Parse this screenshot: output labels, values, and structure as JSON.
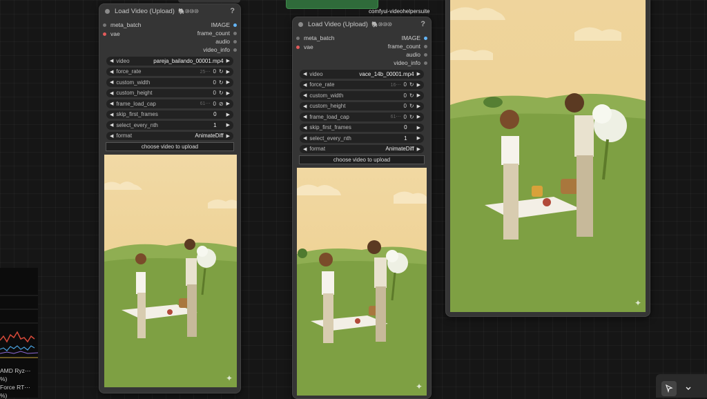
{
  "colors": {
    "canvas": "#161616",
    "node_bg": "#353535",
    "widget_bg": "#222222",
    "port_red": "#e25b5b",
    "port_blue": "#64b5f6"
  },
  "top_partial": {
    "group_label": "comfyui-videohelpersuite"
  },
  "nodes": [
    {
      "title": "Load Video (Upload)",
      "badges": "🐘⑩⑩⑩",
      "help": "?",
      "inputs": [
        "meta_batch",
        "vae"
      ],
      "outputs": [
        "IMAGE",
        "frame_count",
        "audio",
        "video_info"
      ],
      "widgets": [
        {
          "label": "video",
          "value": "pareja_bailando_00001.mp4",
          "ghost": "",
          "extra": ""
        },
        {
          "label": "force_rate",
          "value": "0",
          "ghost": "25⋯",
          "extra": "↻"
        },
        {
          "label": "custom_width",
          "value": "0",
          "ghost": "",
          "extra": "↻"
        },
        {
          "label": "custom_height",
          "value": "0",
          "ghost": "",
          "extra": "↻"
        },
        {
          "label": "frame_load_cap",
          "value": "0",
          "ghost": "61⋯",
          "extra": "⊘"
        },
        {
          "label": "skip_first_frames",
          "value": "0",
          "ghost": "",
          "extra": ""
        },
        {
          "label": "select_every_nth",
          "value": "1",
          "ghost": "",
          "extra": ""
        },
        {
          "label": "format",
          "value": "AnimateDiff",
          "ghost": "",
          "extra": ""
        }
      ],
      "upload_label": "choose video to upload"
    },
    {
      "title": "Load Video (Upload)",
      "badges": "🐘⑩⑩⑩",
      "help": "?",
      "inputs": [
        "meta_batch",
        "vae"
      ],
      "outputs": [
        "IMAGE",
        "frame_count",
        "audio",
        "video_info"
      ],
      "widgets": [
        {
          "label": "video",
          "value": "vace_14b_00001.mp4",
          "ghost": "",
          "extra": ""
        },
        {
          "label": "force_rate",
          "value": "0",
          "ghost": "16⋯",
          "extra": "↻"
        },
        {
          "label": "custom_width",
          "value": "0",
          "ghost": "",
          "extra": "↻"
        },
        {
          "label": "custom_height",
          "value": "0",
          "ghost": "",
          "extra": "↻"
        },
        {
          "label": "frame_load_cap",
          "value": "0",
          "ghost": "61⋯",
          "extra": "↻"
        },
        {
          "label": "skip_first_frames",
          "value": "0",
          "ghost": "",
          "extra": ""
        },
        {
          "label": "select_every_nth",
          "value": "1",
          "ghost": "",
          "extra": ""
        },
        {
          "label": "format",
          "value": "AnimateDiff",
          "ghost": "",
          "extra": ""
        }
      ],
      "upload_label": "choose video to upload"
    }
  ],
  "perf_panel": {
    "lines": [
      "AMD Ryz⋯",
      "%)",
      "Force RT⋯",
      "%)"
    ]
  },
  "toolbar": {
    "pointer_icon": "pointer-icon",
    "chevron_icon": "chevron-down-icon"
  },
  "icons": {
    "sparkle": "sparkle-icon"
  }
}
